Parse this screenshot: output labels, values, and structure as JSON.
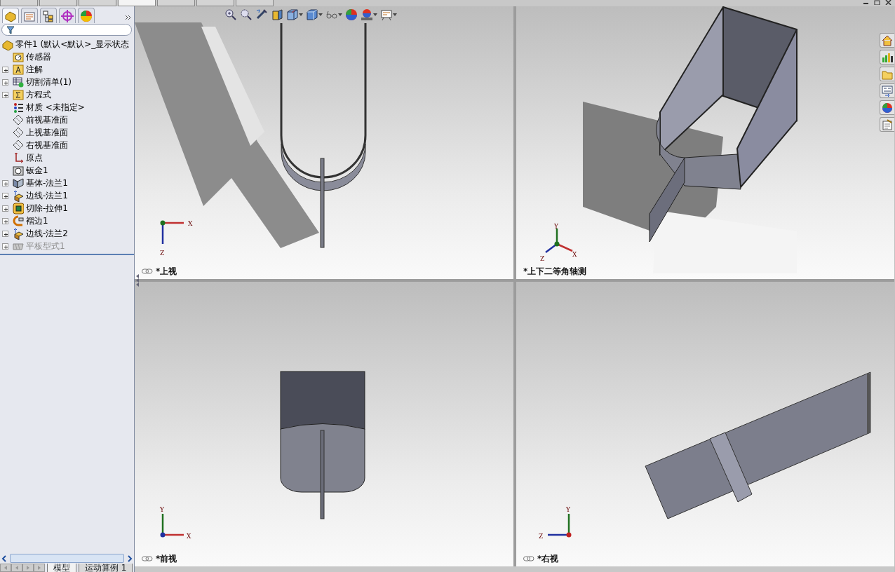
{
  "command_tabs": [
    {
      "selected": false
    },
    {
      "selected": false
    },
    {
      "selected": false
    },
    {
      "selected": true
    },
    {
      "selected": false
    },
    {
      "selected": false
    },
    {
      "selected": false
    }
  ],
  "panel_tabs": [
    {
      "kind": "feature",
      "selected": true
    },
    {
      "kind": "property",
      "selected": false
    },
    {
      "kind": "config",
      "selected": false
    },
    {
      "kind": "dimxpert",
      "selected": false
    },
    {
      "kind": "display",
      "selected": false
    }
  ],
  "tree": {
    "label": "零件1 (默认<默认>_显示状态",
    "children": [
      {
        "kind": "sensor",
        "label": "传感器",
        "expandable": false,
        "disabled": false
      },
      {
        "kind": "annotation",
        "label": "注解",
        "expandable": true,
        "disabled": false
      },
      {
        "kind": "cutlist",
        "label": "切割清单(1)",
        "expandable": true,
        "disabled": false
      },
      {
        "kind": "equation",
        "label": "方程式",
        "expandable": true,
        "disabled": false
      },
      {
        "kind": "material",
        "label": "材质 <未指定>",
        "expandable": false,
        "disabled": false
      },
      {
        "kind": "plane",
        "label": "前视基准面",
        "expandable": false,
        "disabled": false
      },
      {
        "kind": "plane",
        "label": "上视基准面",
        "expandable": false,
        "disabled": false
      },
      {
        "kind": "plane",
        "label": "右视基准面",
        "expandable": false,
        "disabled": false
      },
      {
        "kind": "origin",
        "label": "原点",
        "expandable": false,
        "disabled": false
      },
      {
        "kind": "sheetmetal",
        "label": "钣金1",
        "expandable": false,
        "disabled": false
      },
      {
        "kind": "baseflange",
        "label": "基体-法兰1",
        "expandable": true,
        "disabled": false
      },
      {
        "kind": "edgeflange",
        "label": "边线-法兰1",
        "expandable": true,
        "disabled": false
      },
      {
        "kind": "cut",
        "label": "切除-拉伸1",
        "expandable": true,
        "disabled": false
      },
      {
        "kind": "hem",
        "label": "褶边1",
        "expandable": true,
        "disabled": false
      },
      {
        "kind": "edgeflange",
        "label": "边线-法兰2",
        "expandable": true,
        "disabled": false
      },
      {
        "kind": "flatpattern",
        "label": "平板型式1",
        "expandable": true,
        "disabled": true
      }
    ]
  },
  "viewports": [
    {
      "kind": "top",
      "label": "*上视",
      "linked": true,
      "axes": [
        "X",
        "Z"
      ]
    },
    {
      "kind": "iso",
      "label": "*上下二等角轴测",
      "linked": false,
      "axes": [
        "Y",
        "Z",
        "X"
      ]
    },
    {
      "kind": "front",
      "label": "*前视",
      "linked": true,
      "axes": [
        "Y",
        "X"
      ]
    },
    {
      "kind": "right",
      "label": "*右视",
      "linked": true,
      "axes": [
        "Y",
        "Z"
      ]
    }
  ],
  "bottom_tabs": [
    {
      "label": "模型",
      "selected": true
    },
    {
      "label": "运动算例 1",
      "selected": false
    }
  ]
}
